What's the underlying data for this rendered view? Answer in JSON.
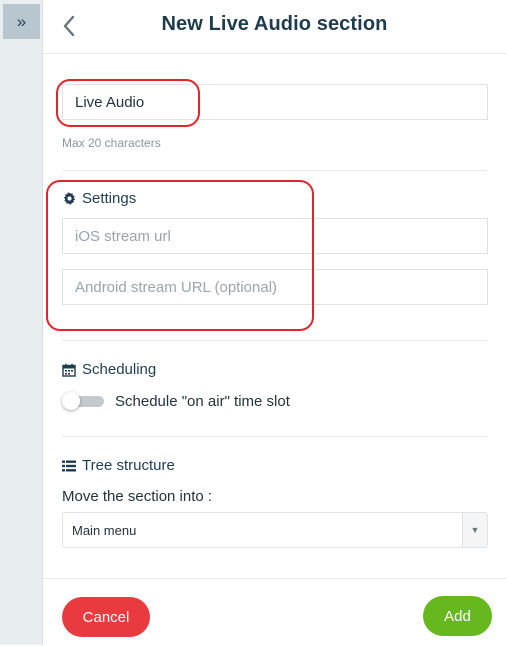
{
  "rail": {
    "toggle_glyph": "»"
  },
  "header": {
    "title": "New Live Audio section",
    "back_icon": "chevron-left-icon"
  },
  "name_field": {
    "value": "Live Audio",
    "hint": "Max 20 characters"
  },
  "settings": {
    "title": "Settings",
    "icon": "gear-icon",
    "ios_placeholder": "iOS stream url",
    "android_placeholder": "Android stream URL (optional)"
  },
  "scheduling": {
    "title": "Scheduling",
    "icon": "calendar-icon",
    "toggle_label": "Schedule \"on air\" time slot",
    "toggle_on": false
  },
  "tree": {
    "title": "Tree structure",
    "icon": "list-icon",
    "move_label": "Move the section into :",
    "selected": "Main menu"
  },
  "footer": {
    "cancel_label": "Cancel",
    "add_label": "Add"
  },
  "colors": {
    "accent_dark": "#1f3c4f",
    "cancel": "#e83a3f",
    "add": "#67b81f",
    "annotation": "#e0252b"
  }
}
